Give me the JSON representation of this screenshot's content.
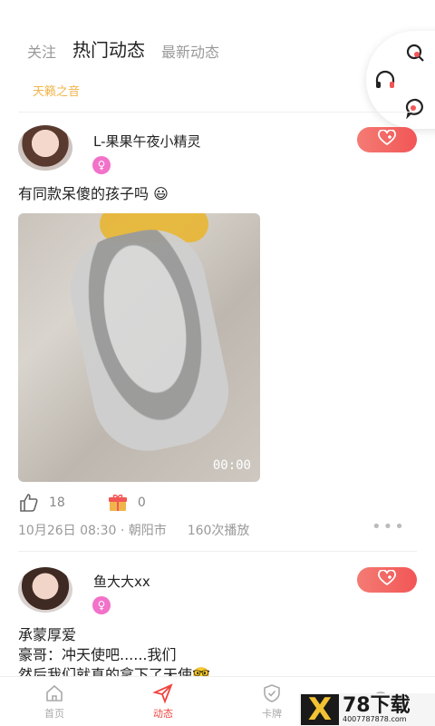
{
  "tabs": [
    "关注",
    "热门动态",
    "最新动态"
  ],
  "active_tab": "热门动态",
  "subtag": "天籁之音",
  "float_icons": [
    "search-icon",
    "headset-icon",
    "message-icon"
  ],
  "posts": [
    {
      "username": "L-果果午夜小精灵",
      "gender_icon": "female-icon",
      "text": "有同款呆傻的孩子吗 😃",
      "media": {
        "type": "video",
        "duration": "00:00"
      },
      "likes": "18",
      "gifts": "0",
      "date": "10月26日 08:30",
      "location": "· 朝阳市",
      "plays": "160次播放"
    },
    {
      "username": "鱼大大xx",
      "gender_icon": "female-icon",
      "lines": [
        "承蒙厚爱",
        "豪哥：冲天使吧......我们",
        "然后我们就真的拿下了天使🤓"
      ]
    }
  ],
  "bottom_nav": [
    {
      "label": "首页",
      "icon": "home-icon",
      "active": false
    },
    {
      "label": "动态",
      "icon": "send-icon",
      "active": true
    },
    {
      "label": "卡牌",
      "icon": "shield-icon",
      "active": false
    },
    {
      "label": "",
      "icon": "chat-icon",
      "active": false
    }
  ],
  "watermark": {
    "mark": "X",
    "big": "78下载",
    "small": "4007787878.com"
  },
  "colors": {
    "accent": "#f0453f",
    "follow": "#f25656",
    "gold": "#f1b44a",
    "female": "#f271c9"
  }
}
